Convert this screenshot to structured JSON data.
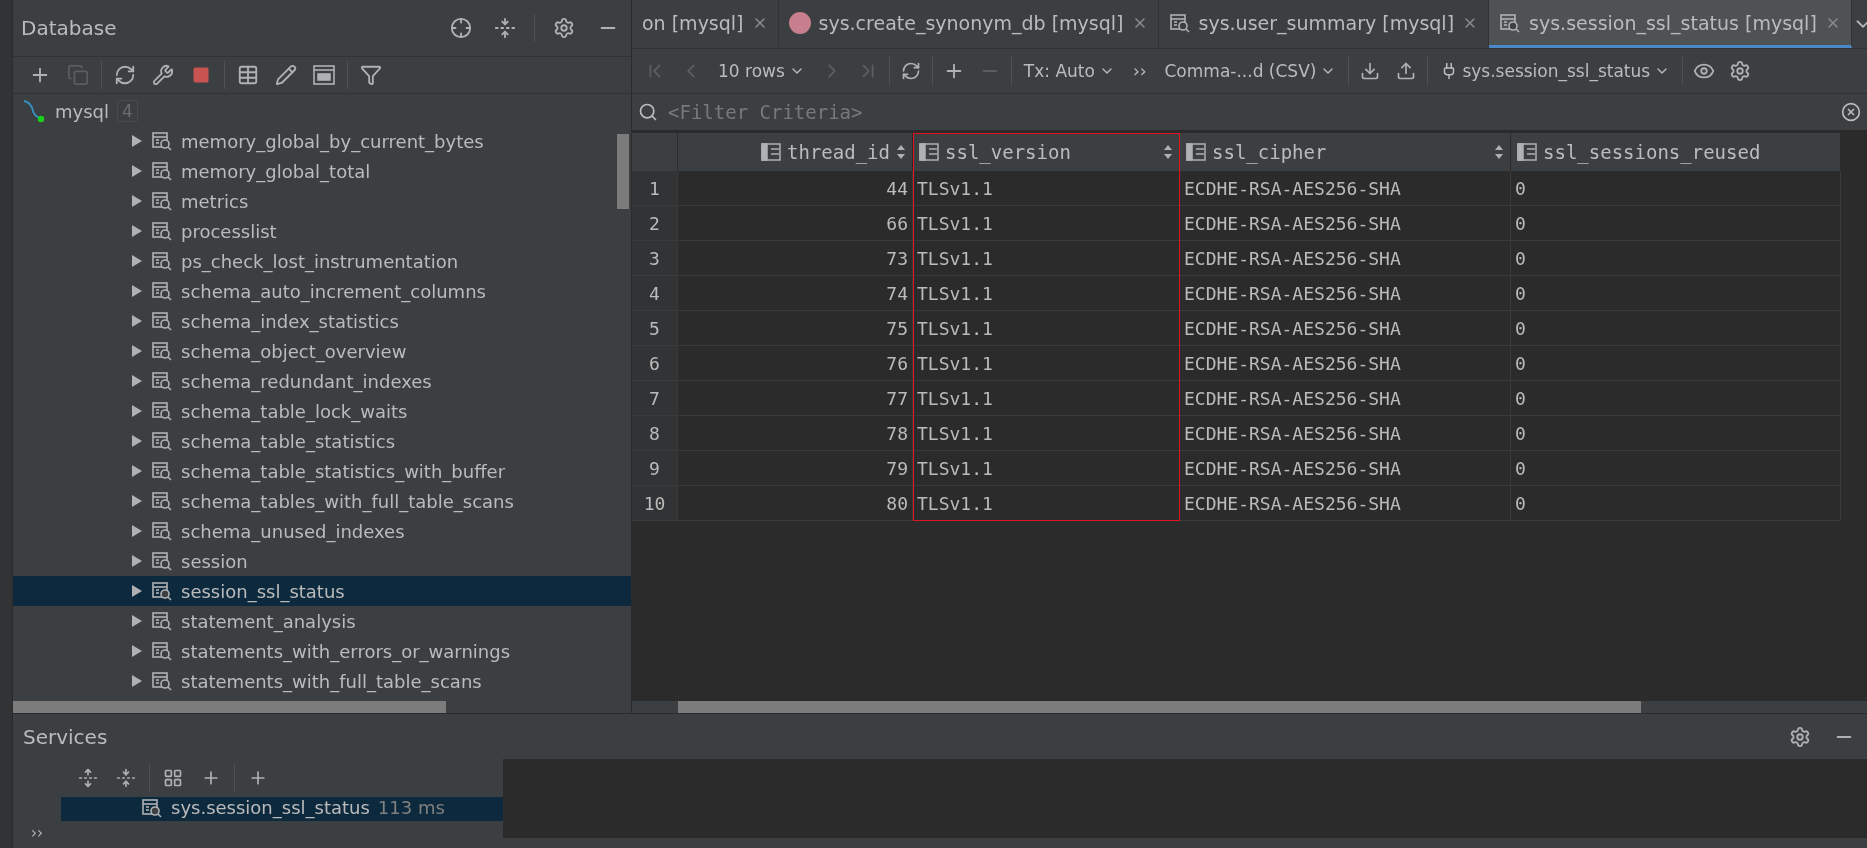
{
  "database_panel": {
    "title": "Database",
    "toolbar": [
      {
        "kind": "add",
        "disabled": false
      },
      {
        "kind": "copy",
        "disabled": true
      },
      {
        "kind": "sep"
      },
      {
        "kind": "refresh",
        "disabled": false
      },
      {
        "kind": "tools",
        "disabled": false
      },
      {
        "kind": "stop",
        "disabled": false
      },
      {
        "kind": "sep"
      },
      {
        "kind": "table",
        "disabled": false
      },
      {
        "kind": "edit",
        "disabled": false
      },
      {
        "kind": "console",
        "disabled": false
      },
      {
        "kind": "sep"
      },
      {
        "kind": "filter",
        "disabled": false
      }
    ],
    "tree": [
      {
        "label": "mysql",
        "badge": "4",
        "selected": false,
        "children": [
          {
            "label": "memory_global_by_current_bytes",
            "selected": false
          },
          {
            "label": "memory_global_total",
            "selected": false
          },
          {
            "label": "metrics",
            "selected": false
          },
          {
            "label": "processlist",
            "selected": false
          },
          {
            "label": "ps_check_lost_instrumentation",
            "selected": false
          },
          {
            "label": "schema_auto_increment_columns",
            "selected": false
          },
          {
            "label": "schema_index_statistics",
            "selected": false
          },
          {
            "label": "schema_object_overview",
            "selected": false
          },
          {
            "label": "schema_redundant_indexes",
            "selected": false
          },
          {
            "label": "schema_table_lock_waits",
            "selected": false
          },
          {
            "label": "schema_table_statistics",
            "selected": false
          },
          {
            "label": "schema_table_statistics_with_buffer",
            "selected": false
          },
          {
            "label": "schema_tables_with_full_table_scans",
            "selected": false
          },
          {
            "label": "schema_unused_indexes",
            "selected": false
          },
          {
            "label": "session",
            "selected": false
          },
          {
            "label": "session_ssl_status",
            "selected": true
          },
          {
            "label": "statement_analysis",
            "selected": false
          },
          {
            "label": "statements_with_errors_or_warnings",
            "selected": false
          },
          {
            "label": "statements_with_full_table_scans",
            "selected": false
          }
        ]
      }
    ]
  },
  "editor_tabs": [
    {
      "label": "on [mysql]",
      "kind": "plain",
      "selected": false
    },
    {
      "label": "sys.create_synonym_db [mysql]",
      "kind": "procedure",
      "selected": false
    },
    {
      "label": "sys.user_summary [mysql]",
      "kind": "view",
      "selected": false
    },
    {
      "label": "sys.session_ssl_status [mysql]",
      "kind": "view",
      "selected": true
    }
  ],
  "result_toolbar": {
    "nav": [
      {
        "kind": "first",
        "disabled": true
      },
      {
        "kind": "prev",
        "disabled": true
      }
    ],
    "page_size": "10 rows",
    "nav_after": [
      {
        "kind": "next",
        "disabled": true
      },
      {
        "kind": "last",
        "disabled": true
      }
    ],
    "edit": [
      {
        "kind": "add",
        "disabled": false
      },
      {
        "kind": "remove",
        "disabled": true
      }
    ],
    "transaction": "Tx: Auto",
    "more": "››",
    "export_format": "Comma-...d (CSV)",
    "data_source": "sys.session_ssl_status"
  },
  "filter": {
    "placeholder": "<Filter Criteria>"
  },
  "table": {
    "columns": [
      {
        "name": "thread_id",
        "numeric": true,
        "sortable": true,
        "highlighted": false
      },
      {
        "name": "ssl_version",
        "numeric": false,
        "sortable": true,
        "highlighted": true
      },
      {
        "name": "ssl_cipher",
        "numeric": false,
        "sortable": true,
        "highlighted": false
      },
      {
        "name": "ssl_sessions_reused",
        "numeric": false,
        "sortable": false,
        "highlighted": false
      }
    ],
    "rows": [
      {
        "number": "1",
        "cells": [
          "44",
          "TLSv1.1",
          "ECDHE-RSA-AES256-SHA",
          "0"
        ]
      },
      {
        "number": "2",
        "cells": [
          "66",
          "TLSv1.1",
          "ECDHE-RSA-AES256-SHA",
          "0"
        ]
      },
      {
        "number": "3",
        "cells": [
          "73",
          "TLSv1.1",
          "ECDHE-RSA-AES256-SHA",
          "0"
        ]
      },
      {
        "number": "4",
        "cells": [
          "74",
          "TLSv1.1",
          "ECDHE-RSA-AES256-SHA",
          "0"
        ]
      },
      {
        "number": "5",
        "cells": [
          "75",
          "TLSv1.1",
          "ECDHE-RSA-AES256-SHA",
          "0"
        ]
      },
      {
        "number": "6",
        "cells": [
          "76",
          "TLSv1.1",
          "ECDHE-RSA-AES256-SHA",
          "0"
        ]
      },
      {
        "number": "7",
        "cells": [
          "77",
          "TLSv1.1",
          "ECDHE-RSA-AES256-SHA",
          "0"
        ]
      },
      {
        "number": "8",
        "cells": [
          "78",
          "TLSv1.1",
          "ECDHE-RSA-AES256-SHA",
          "0"
        ]
      },
      {
        "number": "9",
        "cells": [
          "79",
          "TLSv1.1",
          "ECDHE-RSA-AES256-SHA",
          "0"
        ]
      },
      {
        "number": "10",
        "cells": [
          "80",
          "TLSv1.1",
          "ECDHE-RSA-AES256-SHA",
          "0"
        ]
      }
    ]
  },
  "services": {
    "title": "Services",
    "more": "››",
    "items": [
      {
        "label": "sys.session_ssl_status",
        "duration": "113 ms",
        "selected": true
      }
    ]
  }
}
